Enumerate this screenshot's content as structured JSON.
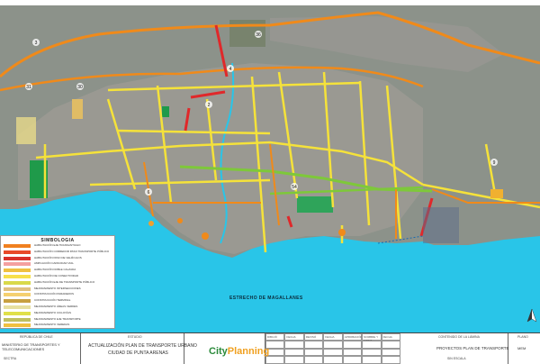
{
  "legend": {
    "title": "SIMBOLOGIA",
    "items": [
      {
        "label": "HABILITACIÓN EJE TRANSANTIAGO",
        "color": "#f08020"
      },
      {
        "label": "HABILITACIÓN CORREDOR PASO TRANSPORTE PÚBLICO",
        "color": "#e84a2a"
      },
      {
        "label": "HABILITACIÓN PASO DE VEHÍCULOS",
        "color": "#d9302a"
      },
      {
        "label": "AMPLIACIÓN CAPACIDAD VIAL",
        "color": "#f4a0a0"
      },
      {
        "label": "HABILITACIÓN DOBLE CALZADA",
        "color": "#f0c040"
      },
      {
        "label": "HABILITACIÓN DE CONECTIVIDAD",
        "color": "#f7e04a"
      },
      {
        "label": "HABILITACIÓN EJE DE TRANSPORTE PÚBLICO",
        "color": "#d9d94a"
      },
      {
        "label": "MEJORAMIENTO INTERSECCIONES",
        "color": "#e0c080"
      },
      {
        "label": "CONSTRUCCIÓN PARADEROS",
        "color": "#f5d070"
      },
      {
        "label": "CONSTRUCCIÓN TERMINAL",
        "color": "#c8a040"
      },
      {
        "label": "MEJORAMIENTO ÁREAS VERDES",
        "color": "#e7e0a0"
      },
      {
        "label": "MEJORAMIENTO CICLOVÍAS",
        "color": "#e0e04a"
      },
      {
        "label": "MEJORAMIENTO EJE TRANSPORTE",
        "color": "#c0c060"
      },
      {
        "label": "MEJORAMIENTO VEREDAS",
        "color": "#f0c040"
      }
    ]
  },
  "map": {
    "water_color": "#29c5e8",
    "land_color": "#8a9088",
    "road_colors": {
      "ring": "#f08a1a",
      "yellow": "#f5e23a",
      "green": "#7ec83a",
      "red": "#e0282a"
    },
    "strait_label": "ESTRECHO DE MAGALLANES",
    "labels": [
      {
        "text": "36"
      },
      {
        "text": "4"
      },
      {
        "text": "3"
      },
      {
        "text": "9"
      },
      {
        "text": "54"
      },
      {
        "text": "6"
      },
      {
        "text": "2"
      },
      {
        "text": "31"
      },
      {
        "text": "30"
      }
    ]
  },
  "title_block": {
    "ministry_header": "REPÚBLICA DE CHILE",
    "ministry": "MINISTERIO DE TRANSPORTES Y TELECOMUNICACIONES",
    "ministry_sub": "SECTRA",
    "study_header": "ESTUDIO",
    "study": "ACTUALIZACIÓN PLAN DE TRANSPORTE URBANO",
    "study_city": "CIUDAD DE PUNTA ARENAS",
    "logo_a": "City",
    "logo_b": "Planning",
    "grid_headers": [
      "DIBUJÓ",
      "FECHA",
      "REVISÓ",
      "FECHA",
      "APROBACIÓN",
      "NOMBRE Y FIRMA",
      "FECHA"
    ],
    "contents_header": "CONTENIDO DE LA LÁMINA",
    "contents": "PROYECTOS PLAN DE TRANSPORTE",
    "scale": "SIN ESCALA",
    "sheet_header": "PLANO",
    "sheet": "MEM"
  }
}
